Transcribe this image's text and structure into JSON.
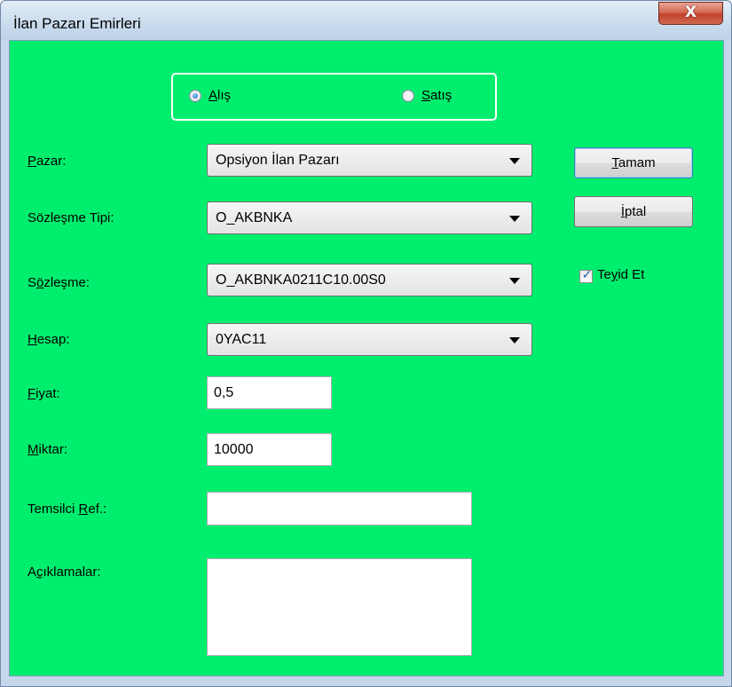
{
  "window": {
    "title": "İlan Pazarı Emirleri",
    "close_glyph": "X"
  },
  "side": {
    "buy": {
      "underline": "A",
      "rest": "lış",
      "checked": true
    },
    "sell": {
      "underline": "S",
      "rest": "atış",
      "checked": false
    }
  },
  "fields": {
    "pazar": {
      "label_u": "P",
      "label_rest": "azar:",
      "value": "Opsiyon İlan Pazarı"
    },
    "tip": {
      "label": "Sözleşme Tipi:",
      "value": "O_AKBNKA"
    },
    "sozlesme": {
      "label_pre": "S",
      "label_u": "ö",
      "label_rest": "zleşme:",
      "value": "O_AKBNKA0211C10.00S0"
    },
    "hesap": {
      "label_u": "H",
      "label_rest": "esap:",
      "value": "0YAC11"
    },
    "fiyat": {
      "label_u": "F",
      "label_rest": "iyat:",
      "value": "0,5"
    },
    "miktar": {
      "label_u": "M",
      "label_rest": "iktar:",
      "value": "10000"
    },
    "temsilci": {
      "label_pre": "Temsilci ",
      "label_u": "R",
      "label_rest": "ef.:",
      "value": ""
    },
    "aciklama": {
      "label_pre": "A",
      "label_u": "ç",
      "label_rest": "ıklamalar:",
      "value": ""
    }
  },
  "buttons": {
    "ok": {
      "underline": "T",
      "rest": "amam"
    },
    "cancel": {
      "underline": "İ",
      "rest": "ptal"
    }
  },
  "confirm": {
    "pre": "Te",
    "underline": "y",
    "rest": "id Et",
    "checked": true,
    "mark": "✓"
  },
  "colors": {
    "background": "#00ee6e",
    "window_frame": "#c5d7ea",
    "close_button": "#c2412b"
  }
}
